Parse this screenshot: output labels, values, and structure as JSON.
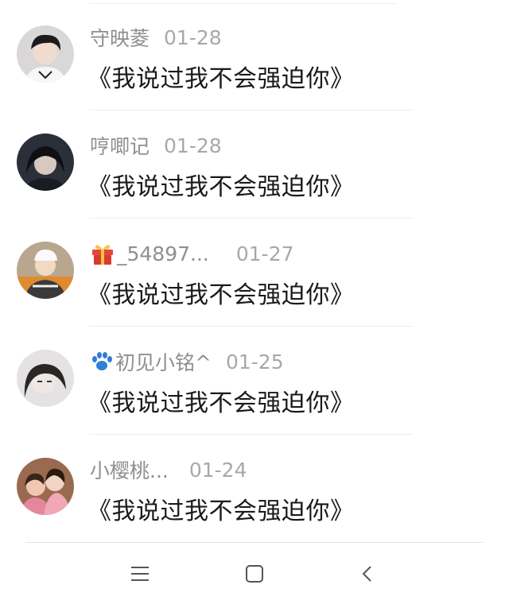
{
  "comments": [
    {
      "user": "守映菱",
      "date": "01-28",
      "text": "《我说过我不会强迫你》",
      "badge": ""
    },
    {
      "user": "哼唧记",
      "date": "01-28",
      "text": "《我说过我不会强迫你》",
      "badge": ""
    },
    {
      "user": "_54897...",
      "date": "01-27",
      "text": "《我说过我不会强迫你》",
      "badge": "gift-icon"
    },
    {
      "user": "初见小铭^",
      "date": "01-25",
      "text": "《我说过我不会强迫你》",
      "badge": "paw-icon"
    },
    {
      "user": "小樱桃...",
      "date": "01-24",
      "text": "《我说过我不会强迫你》",
      "badge": ""
    }
  ],
  "navbar": {
    "icons": [
      "menu-icon",
      "home-icon",
      "back-icon"
    ]
  },
  "colors": {
    "username": "#8f8f8f",
    "date": "#a8a8a8",
    "content": "#1a1a1a",
    "gift": "#e8453c",
    "paw": "#2f7fd6"
  }
}
